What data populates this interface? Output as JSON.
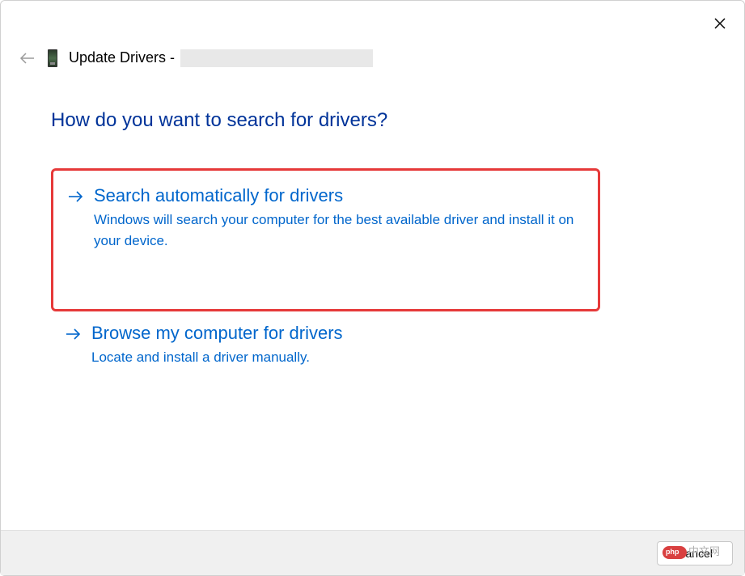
{
  "header": {
    "title_prefix": "Update Drivers - "
  },
  "heading": "How do you want to search for drivers?",
  "options": [
    {
      "title": "Search automatically for drivers",
      "description": "Windows will search your computer for the best available driver and install it on your device."
    },
    {
      "title": "Browse my computer for drivers",
      "description": "Locate and install a driver manually."
    }
  ],
  "footer": {
    "cancel_label": "Cancel"
  },
  "watermark_text": "中文网"
}
